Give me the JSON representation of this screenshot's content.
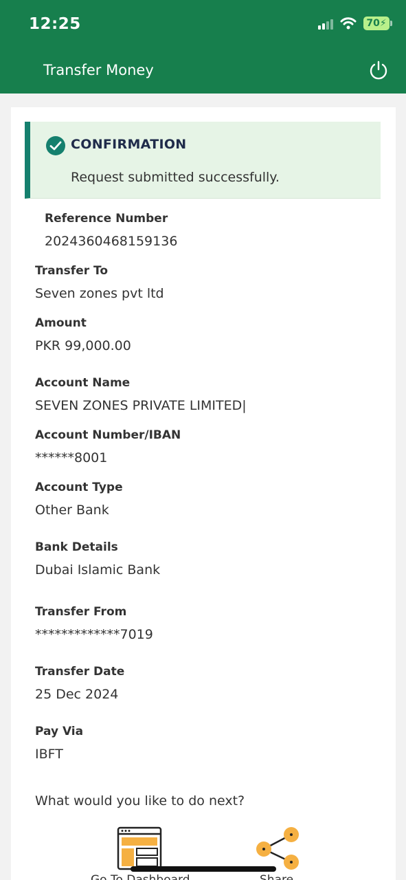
{
  "status_bar": {
    "time": "12:25",
    "battery": "70"
  },
  "header": {
    "title": "Transfer Money"
  },
  "confirmation": {
    "title": "CONFIRMATION",
    "message": "Request submitted successfully."
  },
  "fields": [
    {
      "label": "Reference Number",
      "value": "2024360468159136"
    },
    {
      "label": "Transfer To",
      "value": "Seven zones pvt ltd"
    },
    {
      "label": "Amount",
      "value": "PKR 99,000.00"
    },
    {
      "label": "Account Name",
      "value": "SEVEN ZONES PRIVATE LIMITED|"
    },
    {
      "label": "Account Number/IBAN",
      "value": "******8001"
    },
    {
      "label": "Account Type",
      "value": "Other Bank"
    },
    {
      "label": "Bank Details",
      "value": "Dubai Islamic Bank"
    },
    {
      "label": "Transfer From",
      "value": "*************7019"
    },
    {
      "label": "Transfer Date",
      "value": "25 Dec 2024"
    },
    {
      "label": "Pay Via",
      "value": "IBFT"
    }
  ],
  "next": {
    "prompt": "What would you like to do next?",
    "actions": [
      {
        "label": "Go To Dashboard",
        "icon": "dashboard-icon"
      },
      {
        "label": "Share",
        "icon": "share-icon"
      }
    ]
  },
  "colors": {
    "header": "#177f4d",
    "confirm_bg": "#e6f4e6",
    "accent": "#f5b042"
  }
}
